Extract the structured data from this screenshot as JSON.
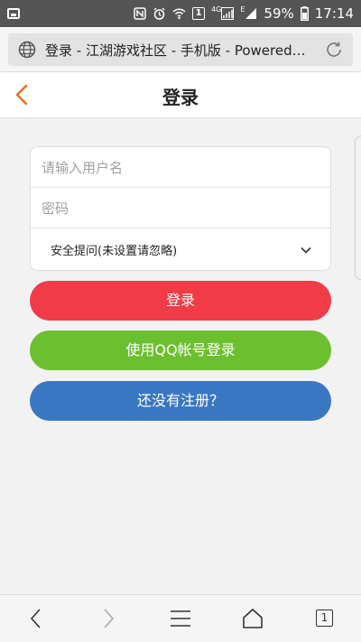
{
  "status_bar": {
    "network_label": "4G",
    "network_label_2": "E",
    "sim_badge": "1",
    "battery": "59%",
    "time": "17:14"
  },
  "browser": {
    "url_text": "登录 - 江湖游戏社区 - 手机版 - Powered by…",
    "tab_count": "1"
  },
  "header": {
    "title": "登录"
  },
  "form": {
    "username_placeholder": "请输入用户名",
    "password_placeholder": "密码",
    "security_question_label": "安全提问(未设置请忽略)"
  },
  "buttons": {
    "login": "登录",
    "qq_login": "使用QQ帐号登录",
    "register": "还没有注册？"
  },
  "colors": {
    "back_arrow": "#e8702a",
    "login_button": "#f13b47",
    "qq_button": "#6cbf2e",
    "register_button": "#3a77c2"
  }
}
